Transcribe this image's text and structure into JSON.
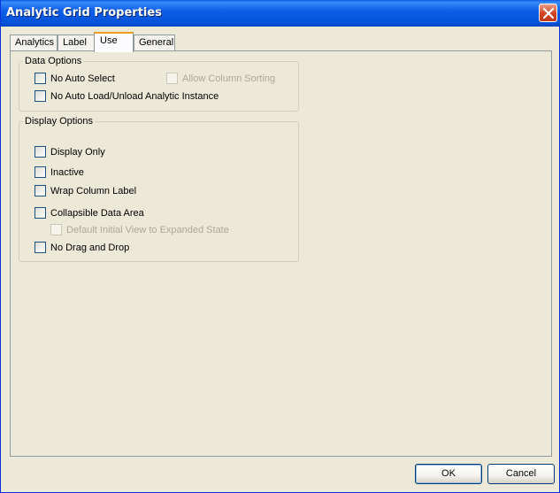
{
  "window": {
    "title": "Analytic Grid Properties"
  },
  "tabs": [
    {
      "label": "Analytics",
      "active": false
    },
    {
      "label": "Label",
      "active": false
    },
    {
      "label": "Use",
      "active": true
    },
    {
      "label": "General",
      "active": false
    }
  ],
  "data_options": {
    "legend": "Data Options",
    "no_auto_select": {
      "label": "No Auto Select",
      "checked": false,
      "enabled": true
    },
    "allow_column_sorting": {
      "label": "Allow Column Sorting",
      "checked": false,
      "enabled": false
    },
    "no_auto_load": {
      "label": "No Auto Load/Unload Analytic Instance",
      "checked": false,
      "enabled": true
    }
  },
  "display_options": {
    "legend": "Display Options",
    "display_only": {
      "label": "Display Only",
      "checked": false,
      "enabled": true
    },
    "inactive": {
      "label": "Inactive",
      "checked": false,
      "enabled": true
    },
    "wrap_column_label": {
      "label": "Wrap Column Label",
      "checked": false,
      "enabled": true
    },
    "collapsible_data_area": {
      "label": "Collapsible Data Area",
      "checked": false,
      "enabled": true
    },
    "default_initial_view": {
      "label": "Default Initial View to Expanded State",
      "checked": false,
      "enabled": false
    },
    "no_drag_and_drop": {
      "label": "No Drag and Drop",
      "checked": false,
      "enabled": true
    }
  },
  "buttons": {
    "ok": "OK",
    "cancel": "Cancel"
  },
  "colors": {
    "titlebar": "#0552D8",
    "window_bg": "#ECE9D8",
    "active_tab_accent": "#F0A020"
  },
  "icons": {
    "close": "close-icon"
  }
}
